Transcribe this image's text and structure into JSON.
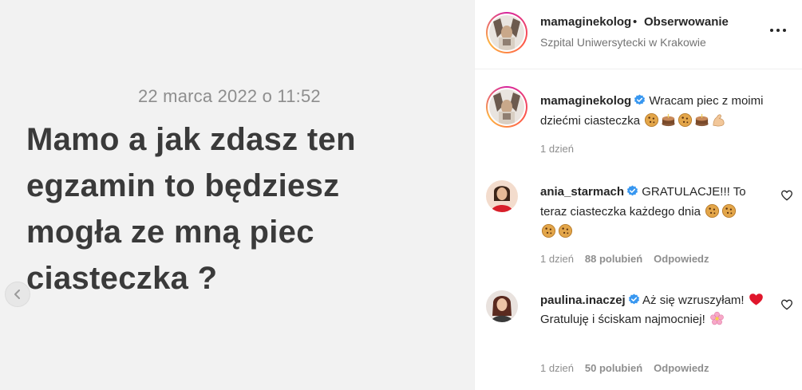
{
  "media": {
    "date": "22 marca 2022 o 11:52",
    "text": "Mamo a jak zdasz ten egzamin to będziesz mogła ze mną piec ciasteczka ?"
  },
  "header": {
    "username": "mamaginekolog",
    "separator": "•",
    "follow_label": "Obserwowanie",
    "location": "Szpital Uniwersytecki w Krakowie"
  },
  "caption": {
    "username": "mamaginekolog",
    "text": "Wracam piec z moimi dziećmi ciasteczka",
    "emojis": [
      "cookie",
      "cake",
      "cookie",
      "cake",
      "flexed-biceps"
    ],
    "time": "1 dzień"
  },
  "comments": [
    {
      "username": "ania_starmach",
      "text": "GRATULACJE!!! To teraz ciasteczka każdego dnia",
      "emojis": [
        "cookie",
        "cookie",
        "cookie",
        "cookie"
      ],
      "time": "1 dzień",
      "likes": "88 polubień",
      "reply_label": "Odpowiedz"
    },
    {
      "username": "paulina.inaczej",
      "text_part1": "Aż się wzruszyłam!",
      "text_part2": "Gratuluję i ściskam najmocniej!",
      "emojis": [
        "red-heart",
        "cherry-blossom"
      ],
      "time": "1 dzień",
      "likes": "50 polubień",
      "reply_label": "Odpowiedz"
    }
  ],
  "colors": {
    "verified": "#3897f0",
    "muted": "#8e8e8e",
    "text": "#262626"
  }
}
